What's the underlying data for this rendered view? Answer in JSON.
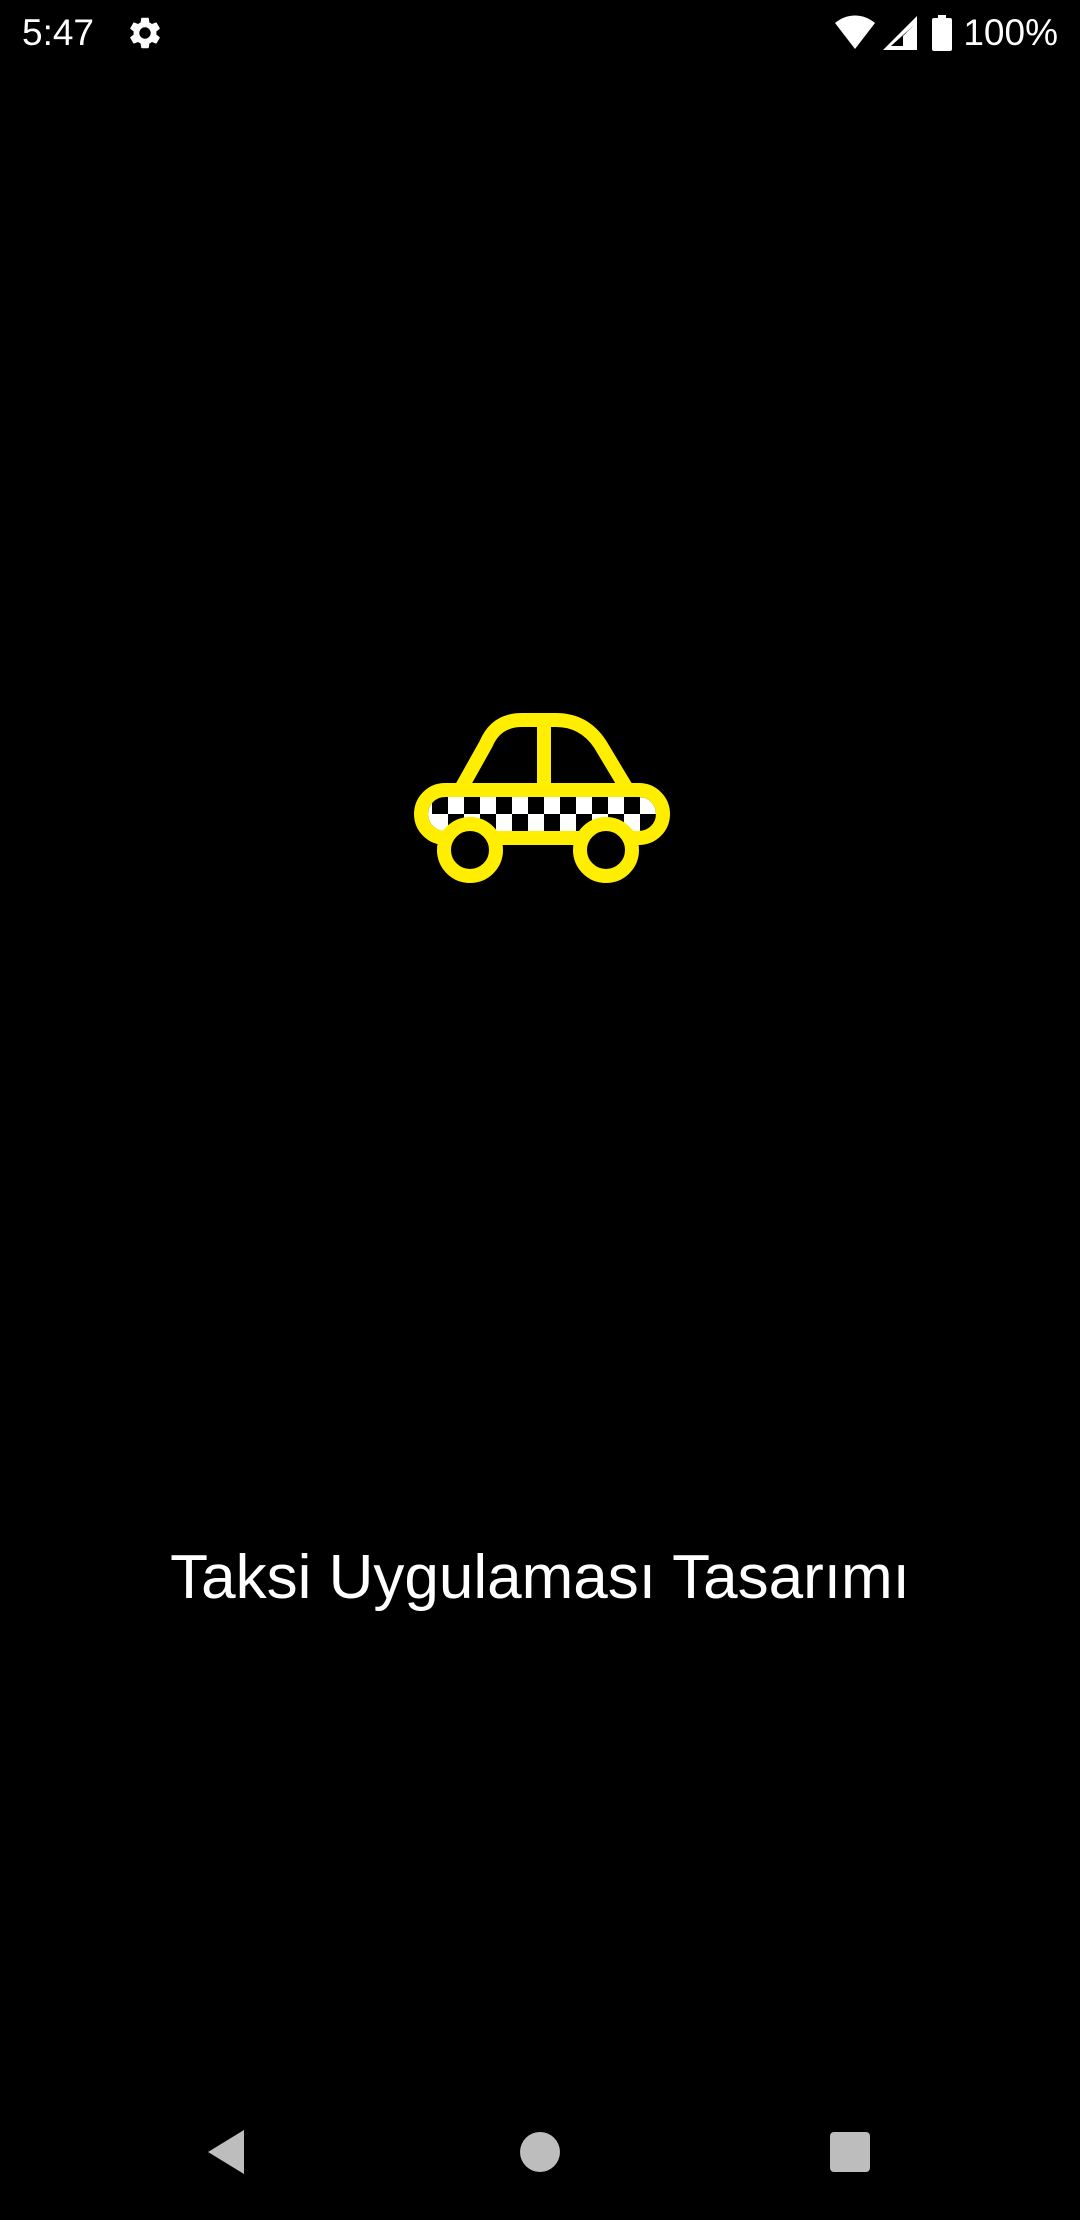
{
  "status_bar": {
    "time": "5:47",
    "battery_text": "100%",
    "icons": [
      "gear-icon",
      "wifi-icon",
      "signal-icon",
      "battery-icon"
    ]
  },
  "splash": {
    "logo_icon": "taxi-icon",
    "title": "Taksi Uygulaması Tasarımı"
  },
  "colors": {
    "background": "#000000",
    "taxi_yellow": "#FFEE00",
    "text": "#FFFFFF",
    "nav_icons": "#BDBDBD"
  },
  "nav_bar": {
    "buttons": [
      "back-icon",
      "home-icon",
      "recents-icon"
    ]
  }
}
